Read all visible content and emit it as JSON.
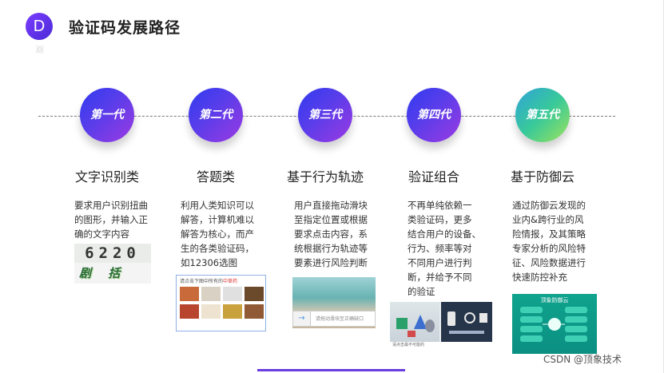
{
  "header": {
    "logo_letter": "D",
    "logo_mark": "✕",
    "title": "验证码发展路径"
  },
  "stages": [
    {
      "badge": "第一代",
      "title": "文字识别类",
      "desc": [
        "要求用户识别扭曲",
        "的图形，并输入正",
        "确的文字内容"
      ],
      "image": {
        "digits": "6220",
        "chars": "剧 括 以"
      }
    },
    {
      "badge": "第二代",
      "title": "答题类",
      "desc": [
        "利用人类知识可以",
        "解答，计算机难以",
        "解答为核心，而产",
        "生的各类验证码，",
        "如12306选图"
      ],
      "image": {
        "prompt_prefix": "请点击下图中所有的",
        "prompt_keyword": "中草药"
      }
    },
    {
      "badge": "第三代",
      "title": "基于行为轨迹",
      "desc": [
        "用户直接拖动滑块",
        "至指定位置或根据",
        "要求点击内容，系",
        "统根据行为轨迹等",
        "要素进行风险判断"
      ],
      "image": {
        "hint": "请拖动滑块至正确缺口"
      }
    },
    {
      "badge": "第四代",
      "title": "验证组合",
      "desc": [
        "不再单纯依赖一",
        "类验证码，更多",
        "结合用户的设备、",
        "行为、频率等对",
        "不同用户进行判",
        "断，并给予不同",
        "的验证"
      ],
      "image": {
        "caption": "请点击最不可能的"
      }
    },
    {
      "badge": "第五代",
      "title": "基于防御云",
      "desc": [
        "通过防御云发现的",
        "业内&跨行业的风",
        "险情报，及其策略",
        "专家分析的风险特",
        "征、风险数据进行",
        "快速防控补充"
      ],
      "image": {
        "caption": "顶象防御云"
      }
    }
  ],
  "watermark": "CSDN @顶象技术",
  "colors": {
    "circle_gradient": [
      "#2e3cf0",
      "#9b3ae2"
    ],
    "circle_gradient_green": [
      "#2fa3d9",
      "#9ee35a"
    ],
    "accent_bar": "#6a3de0"
  }
}
